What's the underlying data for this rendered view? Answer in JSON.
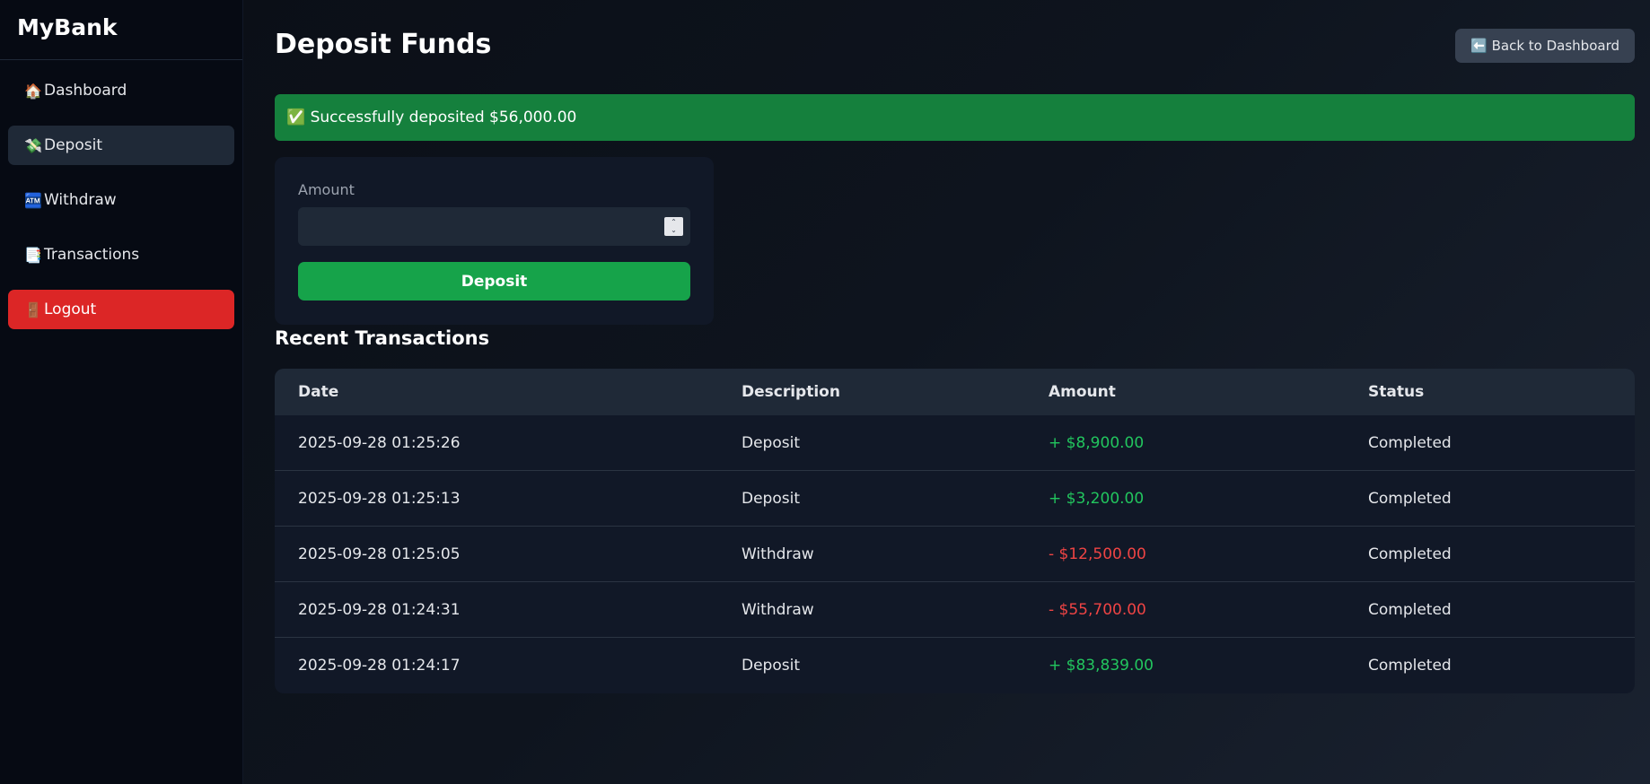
{
  "brand": "MyBank",
  "sidebar": {
    "items": [
      {
        "icon": "🏠",
        "icon_name": "house-icon",
        "label": "Dashboard",
        "active": false
      },
      {
        "icon": "💸",
        "icon_name": "money-wings-icon",
        "label": "Deposit",
        "active": true
      },
      {
        "icon": "🏧",
        "icon_name": "atm-icon",
        "label": "Withdraw",
        "active": false
      },
      {
        "icon": "📑",
        "icon_name": "bookmark-tabs-icon",
        "label": "Transactions",
        "active": false
      },
      {
        "icon": "🚪",
        "icon_name": "door-icon",
        "label": "Logout",
        "active": false
      }
    ]
  },
  "header": {
    "title": "Deposit Funds",
    "back_label": "⬅️ Back to Dashboard"
  },
  "alert": {
    "text": "✅ Successfully deposited $56,000.00"
  },
  "form": {
    "amount_label": "Amount",
    "amount_value": "",
    "submit_label": "Deposit"
  },
  "transactions": {
    "title": "Recent Transactions",
    "columns": [
      "Date",
      "Description",
      "Amount",
      "Status"
    ],
    "rows": [
      {
        "date": "2025-09-28 01:25:26",
        "description": "Deposit",
        "amount": "+ $8,900.00",
        "status": "Completed"
      },
      {
        "date": "2025-09-28 01:25:13",
        "description": "Deposit",
        "amount": "+ $3,200.00",
        "status": "Completed"
      },
      {
        "date": "2025-09-28 01:25:05",
        "description": "Withdraw",
        "amount": "- $12,500.00",
        "status": "Completed"
      },
      {
        "date": "2025-09-28 01:24:31",
        "description": "Withdraw",
        "amount": "- $55,700.00",
        "status": "Completed"
      },
      {
        "date": "2025-09-28 01:24:17",
        "description": "Deposit",
        "amount": "+ $83,839.00",
        "status": "Completed"
      }
    ]
  },
  "colors": {
    "success": "#15803d",
    "primary_button": "#16a34a",
    "logout": "#dc2626",
    "positive_amount": "#22c55e",
    "negative_amount": "#ef4444"
  }
}
